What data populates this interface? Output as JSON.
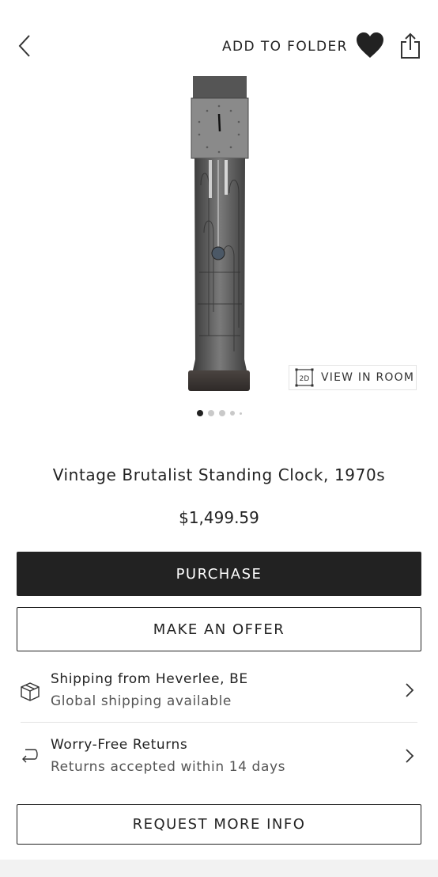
{
  "header": {
    "add_to_folder_label": "ADD TO FOLDER",
    "icons": [
      "back-chevron-icon",
      "heart-icon",
      "share-icon"
    ],
    "heart_color": "#222222"
  },
  "gallery": {
    "view_in_room_badge": "2D",
    "view_in_room_label": "VIEW IN ROOM",
    "image_count": 5,
    "active_index": 0
  },
  "product": {
    "title": "Vintage Brutalist Standing Clock, 1970s",
    "price": "$1,499.59"
  },
  "actions": {
    "purchase_label": "PURCHASE",
    "offer_label": "MAKE AN OFFER",
    "request_info_label": "REQUEST MORE INFO"
  },
  "info": {
    "shipping": {
      "title": "Shipping from Heverlee, BE",
      "subtitle": "Global shipping available",
      "icon": "box-icon"
    },
    "returns": {
      "title": "Worry-Free Returns",
      "subtitle": "Returns accepted within 14 days",
      "icon": "return-arrow-icon"
    }
  },
  "colors": {
    "primary": "#222222",
    "background": "#ffffff",
    "divider": "#e2e2e2",
    "muted_text": "#555555"
  }
}
